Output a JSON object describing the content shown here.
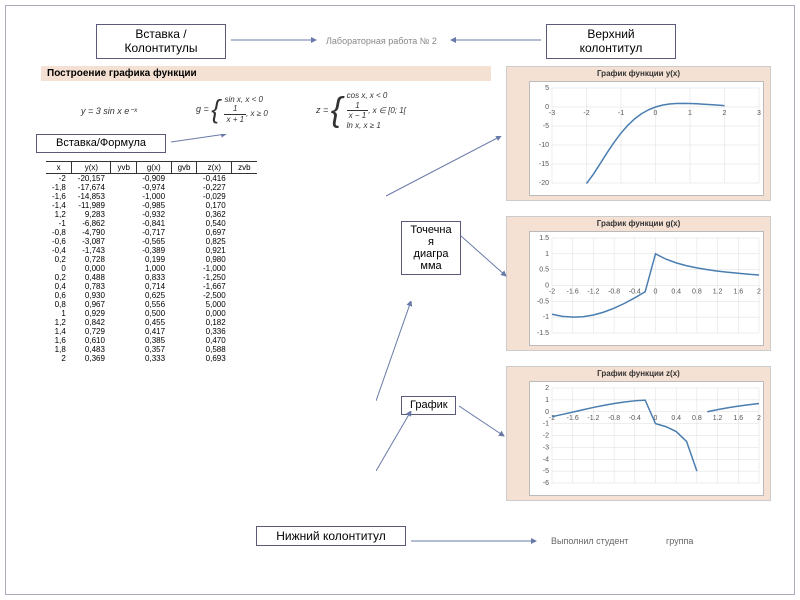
{
  "callouts": {
    "insert_header_footer": "Вставка / Колонтитулы",
    "top_header": "Верхний колонтитул",
    "insert_formula": "Вставка/Формула",
    "scatter_chart": "Точечна\nя диагра\nмма",
    "chart": "График",
    "bottom_footer": "Нижний колонтитул"
  },
  "header": {
    "lab_work": "Лабораторная работа № 2"
  },
  "section_title": "Построение графика функции",
  "formulas": {
    "y": "y = 3 sin x e⁻ˣ",
    "g_piece1_top": "sin x, x < 0",
    "g_piece2_n": "1",
    "g_piece2_d": "x + 1",
    "g_piece2_cond": ", x ≥ 0",
    "g_lhs": "g =",
    "z_lhs": "z =",
    "z_piece1": "cos x, x < 0",
    "z_piece2_n": "1",
    "z_piece2_d": "x − 1",
    "z_piece2_cond": ", x ∈ [0; 1[",
    "z_piece3": "ln x, x ≥ 1"
  },
  "table": {
    "headers": [
      "x",
      "y(x)",
      "yvb",
      "g(x)",
      "gvb",
      "z(x)",
      "zvb"
    ],
    "rows": [
      [
        "-2",
        "-20,157",
        "",
        "-0,909",
        "",
        "-0,416",
        ""
      ],
      [
        "-1,8",
        "-17,674",
        "",
        "-0,974",
        "",
        "-0,227",
        ""
      ],
      [
        "-1,6",
        "-14,853",
        "",
        "-1,000",
        "",
        "-0,029",
        ""
      ],
      [
        "-1,4",
        "-11,989",
        "",
        "-0,985",
        "",
        "0,170",
        ""
      ],
      [
        "1,2",
        "9,283",
        "",
        "-0,932",
        "",
        "0,362",
        ""
      ],
      [
        "-1",
        "-6,862",
        "",
        "-0,841",
        "",
        "0,540",
        ""
      ],
      [
        "-0,8",
        "-4,790",
        "",
        "-0,717",
        "",
        "0,697",
        ""
      ],
      [
        "-0,6",
        "-3,087",
        "",
        "-0,565",
        "",
        "0,825",
        ""
      ],
      [
        "-0,4",
        "-1,743",
        "",
        "-0,389",
        "",
        "0,921",
        ""
      ],
      [
        "0,2",
        "0,728",
        "",
        "0,199",
        "",
        "0,980",
        ""
      ],
      [
        "0",
        "0,000",
        "",
        "1,000",
        "",
        "-1,000",
        ""
      ],
      [
        "0,2",
        "0,488",
        "",
        "0,833",
        "",
        "-1,250",
        ""
      ],
      [
        "0,4",
        "0,783",
        "",
        "0,714",
        "",
        "-1,667",
        ""
      ],
      [
        "0,6",
        "0,930",
        "",
        "0,625",
        "",
        "-2,500",
        ""
      ],
      [
        "0,8",
        "0,967",
        "",
        "0,556",
        "",
        "5,000",
        ""
      ],
      [
        "1",
        "0,929",
        "",
        "0,500",
        "",
        "0,000",
        ""
      ],
      [
        "1,2",
        "0,842",
        "",
        "0,455",
        "",
        "0,182",
        ""
      ],
      [
        "1,4",
        "0,729",
        "",
        "0,417",
        "",
        "0,336",
        ""
      ],
      [
        "1,6",
        "0,610",
        "",
        "0,385",
        "",
        "0,470",
        ""
      ],
      [
        "1,8",
        "0,483",
        "",
        "0,357",
        "",
        "0,588",
        ""
      ],
      [
        "2",
        "0,369",
        "",
        "0,333",
        "",
        "0,693",
        ""
      ]
    ]
  },
  "charts": {
    "y": {
      "title": "График функции y(x)",
      "xticks": [
        -3,
        -2,
        -1,
        0,
        1,
        2,
        3
      ],
      "yticks": [
        -20,
        -15,
        -10,
        -5,
        0,
        5
      ]
    },
    "g": {
      "title": "График функции g(x)",
      "xticks": [
        -2,
        -1.6,
        -1.2,
        -0.8,
        -0.4,
        0,
        0.4,
        0.8,
        1.2,
        1.6,
        2
      ],
      "yticks": [
        -1.5,
        -1.0,
        -0.5,
        0,
        0.5,
        1.0,
        1.5
      ]
    },
    "z": {
      "title": "График функции z(x)",
      "xticks": [
        -2,
        -1.6,
        -1.2,
        -0.8,
        -0.4,
        0,
        0.4,
        0.8,
        1.2,
        1.6,
        2
      ],
      "yticks": [
        -6,
        -5,
        -4,
        -3,
        -2,
        -1,
        0,
        1,
        2
      ]
    }
  },
  "chart_data": [
    {
      "type": "line",
      "title": "График функции y(x)",
      "xlabel": "",
      "ylabel": "",
      "x": [
        -2,
        -1.8,
        -1.6,
        -1.4,
        -1.2,
        -1,
        -0.8,
        -0.6,
        -0.4,
        -0.2,
        0,
        0.2,
        0.4,
        0.6,
        0.8,
        1,
        1.2,
        1.4,
        1.6,
        1.8,
        2
      ],
      "values": [
        -20.157,
        -17.674,
        -14.853,
        -11.989,
        -9.283,
        -6.862,
        -4.79,
        -3.087,
        -1.743,
        -0.728,
        0,
        0.488,
        0.783,
        0.93,
        0.967,
        0.929,
        0.842,
        0.729,
        0.61,
        0.483,
        0.369
      ],
      "xlim": [
        -3,
        3
      ],
      "ylim": [
        -20,
        5
      ]
    },
    {
      "type": "line",
      "title": "График функции g(x)",
      "xlabel": "",
      "ylabel": "",
      "x": [
        -2,
        -1.8,
        -1.6,
        -1.4,
        -1.2,
        -1,
        -0.8,
        -0.6,
        -0.4,
        -0.2,
        0,
        0.2,
        0.4,
        0.6,
        0.8,
        1,
        1.2,
        1.4,
        1.6,
        1.8,
        2
      ],
      "values": [
        -0.909,
        -0.974,
        -1.0,
        -0.985,
        -0.932,
        -0.841,
        -0.717,
        -0.565,
        -0.389,
        -0.199,
        1.0,
        0.833,
        0.714,
        0.625,
        0.556,
        0.5,
        0.455,
        0.417,
        0.385,
        0.357,
        0.333
      ],
      "xlim": [
        -2,
        2
      ],
      "ylim": [
        -1.5,
        1.5
      ]
    },
    {
      "type": "line",
      "title": "График функции z(x)",
      "xlabel": "",
      "ylabel": "",
      "x": [
        -2,
        -1.8,
        -1.6,
        -1.4,
        -1.2,
        -1,
        -0.8,
        -0.6,
        -0.4,
        -0.2,
        0,
        0.2,
        0.4,
        0.6,
        0.8,
        1,
        1.2,
        1.4,
        1.6,
        1.8,
        2
      ],
      "values": [
        -0.416,
        -0.227,
        -0.029,
        0.17,
        0.362,
        0.54,
        0.697,
        0.825,
        0.921,
        0.98,
        -1.0,
        -1.25,
        -1.667,
        -2.5,
        -5.0,
        0.0,
        0.182,
        0.336,
        0.47,
        0.588,
        0.693
      ],
      "xlim": [
        -2,
        2
      ],
      "ylim": [
        -6,
        2
      ]
    }
  ],
  "footer": {
    "student": "Выполнил студент",
    "group": "группа"
  }
}
